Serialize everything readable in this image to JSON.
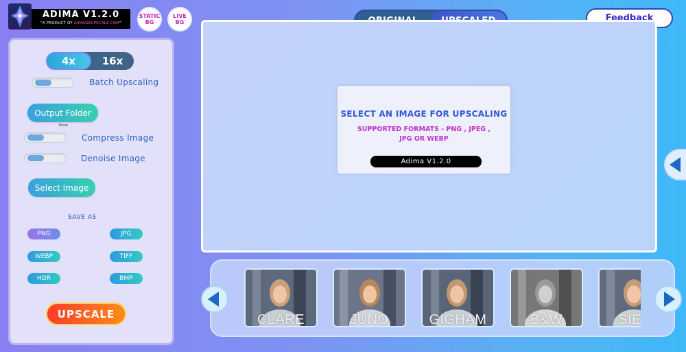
{
  "header": {
    "app_title": "ADIMA V1.2.0",
    "subtitle_prefix": "\"A PRODUCT OF ",
    "subtitle_highlight": "AIIMAGEUPSCALE.COM",
    "subtitle_suffix": "\"",
    "static_bg": "STATIC BG",
    "live_bg": "LIVE BG",
    "view_tabs": [
      {
        "label": "ORIGINAL",
        "active": false
      },
      {
        "label": "UPSCALED",
        "active": true
      }
    ],
    "feedback_label": "Feedback"
  },
  "left_panel": {
    "scale_options": [
      {
        "label": "4x",
        "active": true
      },
      {
        "label": "16x",
        "active": false
      }
    ],
    "batch_label": "Batch Upscaling",
    "output_folder_label": "Output Folder",
    "output_folder_value": "None",
    "compress_label": "Compress Image",
    "denoise_label": "Denoise Image",
    "select_image_label": "Select Image",
    "save_as_label": "SAVE AS",
    "formats": [
      "PNG",
      "JPG",
      "WEBP",
      "TIFF",
      "HDR",
      "BMP"
    ],
    "selected_format": "PNG",
    "upscale_label": "UPSCALE"
  },
  "main": {
    "prompt_title": "SELECT AN IMAGE FOR UPSCALING",
    "supported_formats": "SUPPORTED FORMATS - PNG , JPEG , JPG OR WEBP",
    "version_label": "Adima V1.2.0"
  },
  "filmstrip": {
    "thumbnails": [
      {
        "label": "CLARE",
        "grayscale": false
      },
      {
        "label": "JUNO",
        "grayscale": false
      },
      {
        "label": "GIGHAM",
        "grayscale": false
      },
      {
        "label": "B&W",
        "grayscale": true
      },
      {
        "label": "SIER",
        "grayscale": false
      }
    ]
  },
  "colors": {
    "accent": "#3357d8",
    "formats_text": "#c22fcf",
    "upscale_start": "#ff3d2a",
    "upscale_end": "#ff8b1a"
  },
  "icons": [
    "logo-icon",
    "arrow-left-icon",
    "arrow-right-icon"
  ]
}
